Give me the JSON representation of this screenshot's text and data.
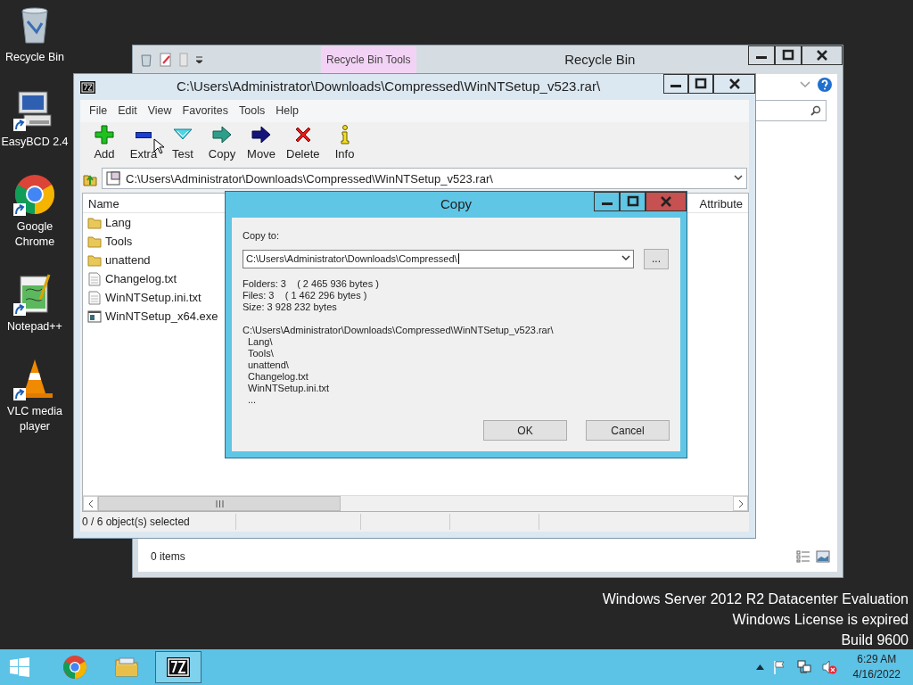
{
  "desktop_icons": [
    {
      "label": "Recycle Bin",
      "kind": "recycle",
      "shortcut": false
    },
    {
      "label": "EasyBCD 2.4",
      "kind": "easybcd",
      "shortcut": true
    },
    {
      "label": "Google Chrome",
      "kind": "chrome",
      "shortcut": true
    },
    {
      "label": "Notepad++",
      "kind": "notepad",
      "shortcut": true
    },
    {
      "label": "VLC media player",
      "kind": "vlc",
      "shortcut": true
    }
  ],
  "explorer_window": {
    "title": "Recycle Bin",
    "context_tab": "Recycle Bin Tools",
    "status": "0 items"
  },
  "archive_window": {
    "title": "C:\\Users\\Administrator\\Downloads\\Compressed\\WinNTSetup_v523.rar\\",
    "menu": [
      "File",
      "Edit",
      "View",
      "Favorites",
      "Tools",
      "Help"
    ],
    "toolbar": [
      {
        "label": "Add",
        "kind": "add"
      },
      {
        "label": "Extra",
        "kind": "extract"
      },
      {
        "label": "Test",
        "kind": "test"
      },
      {
        "label": "Copy",
        "kind": "copy"
      },
      {
        "label": "Move",
        "kind": "move"
      },
      {
        "label": "Delete",
        "kind": "delete"
      },
      {
        "label": "Info",
        "kind": "info"
      }
    ],
    "address": "C:\\Users\\Administrator\\Downloads\\Compressed\\WinNTSetup_v523.rar\\",
    "columns": [
      "Name",
      "Attribute"
    ],
    "files": [
      {
        "name": "Lang",
        "kind": "folder"
      },
      {
        "name": "Tools",
        "kind": "folder"
      },
      {
        "name": "unattend",
        "kind": "folder"
      },
      {
        "name": "Changelog.txt",
        "kind": "text"
      },
      {
        "name": "WinNTSetup.ini.txt",
        "kind": "text"
      },
      {
        "name": "WinNTSetup_x64.exe",
        "kind": "exe"
      }
    ],
    "status": "0 / 6 object(s) selected"
  },
  "copy_dialog": {
    "title": "Copy",
    "copy_to_label": "Copy to:",
    "destination": "C:\\Users\\Administrator\\Downloads\\Compressed\\",
    "browse": "...",
    "summary": [
      "Folders: 3    ( 2 465 936 bytes )",
      "Files: 3    ( 1 462 296 bytes )",
      "Size: 3 928 232 bytes"
    ],
    "source": "C:\\Users\\Administrator\\Downloads\\Compressed\\WinNTSetup_v523.rar\\",
    "items": [
      "Lang\\",
      "Tools\\",
      "unattend\\",
      "Changelog.txt",
      "WinNTSetup.ini.txt",
      "..."
    ],
    "buttons": [
      "OK",
      "Cancel"
    ]
  },
  "system_notice": [
    "Windows Server 2012 R2 Datacenter Evaluation",
    "Windows License is expired",
    "Build 9600"
  ],
  "taskbar": {
    "apps": [
      {
        "kind": "chrome",
        "selected": false
      },
      {
        "kind": "explorer",
        "selected": false
      },
      {
        "kind": "sevenzip",
        "selected": true
      }
    ],
    "clock": {
      "time": "6:29 AM",
      "date": "4/16/2022"
    }
  }
}
